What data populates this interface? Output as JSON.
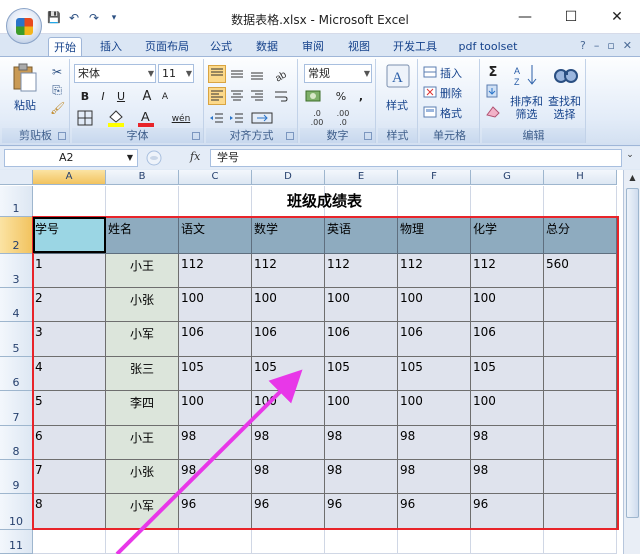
{
  "window": {
    "title": "数据表格.xlsx - Microsoft Excel",
    "min": "—",
    "max": "☐",
    "close": "✕"
  },
  "qat": {
    "save": "💾",
    "undo": "↶",
    "redo": "↷",
    "more": "▾"
  },
  "tabs": [
    {
      "label": "开始",
      "active": true
    },
    {
      "label": "插入"
    },
    {
      "label": "页面布局"
    },
    {
      "label": "公式"
    },
    {
      "label": "数据"
    },
    {
      "label": "审阅"
    },
    {
      "label": "视图"
    },
    {
      "label": "开发工具"
    },
    {
      "label": "pdf toolset"
    }
  ],
  "tab_right": {
    "help": "?",
    "minimize": "–",
    "restore": "▫",
    "close": "✕"
  },
  "ribbon": {
    "clipboard": {
      "label": "剪贴板",
      "paste": "粘贴"
    },
    "font": {
      "label": "字体",
      "name": "宋体",
      "size": "11",
      "bold": "B",
      "italic": "I",
      "underline": "U",
      "grow": "A",
      "shrink": "A",
      "phonetic": "wén"
    },
    "alignment": {
      "label": "对齐方式"
    },
    "number": {
      "label": "数字",
      "format": "常规",
      "percent": "%",
      "comma": ","
    },
    "styles": {
      "label": "样式",
      "button": "样式"
    },
    "cells": {
      "label": "单元格",
      "insert": "插入",
      "delete": "删除",
      "format": "格式"
    },
    "editing": {
      "label": "编辑",
      "sum": "Σ",
      "sort": "排序和",
      "sort2": "筛选",
      "find": "查找和",
      "find2": "选择"
    }
  },
  "formula_bar": {
    "name_box": "A2",
    "fx": "fx",
    "content": "学号"
  },
  "sheet": {
    "columns": [
      "A",
      "B",
      "C",
      "D",
      "E",
      "F",
      "G",
      "H"
    ],
    "rows": [
      "1",
      "2",
      "3",
      "4",
      "5",
      "6",
      "7",
      "8",
      "9",
      "10",
      "11"
    ],
    "title": "班级成绩表",
    "headers": [
      "学号",
      "姓名",
      "语文",
      "数学",
      "英语",
      "物理",
      "化学",
      "总分"
    ],
    "data": [
      [
        "1",
        "小王",
        "112",
        "112",
        "112",
        "112",
        "112",
        "560"
      ],
      [
        "2",
        "小张",
        "100",
        "100",
        "100",
        "100",
        "100",
        ""
      ],
      [
        "3",
        "小军",
        "106",
        "106",
        "106",
        "106",
        "106",
        ""
      ],
      [
        "4",
        "张三",
        "105",
        "105",
        "105",
        "105",
        "105",
        ""
      ],
      [
        "5",
        "李四",
        "100",
        "100",
        "100",
        "100",
        "100",
        ""
      ],
      [
        "6",
        "小王",
        "98",
        "98",
        "98",
        "98",
        "98",
        ""
      ],
      [
        "7",
        "小张",
        "98",
        "98",
        "98",
        "98",
        "98",
        ""
      ],
      [
        "8",
        "小军",
        "96",
        "96",
        "96",
        "96",
        "96",
        ""
      ]
    ]
  },
  "colors": {
    "frame": "#e8242a",
    "arrow": "#e837e8",
    "header_fill": "#8eabbf",
    "name_fill": "#dce5db",
    "data_fill": "#dfe3ed"
  }
}
